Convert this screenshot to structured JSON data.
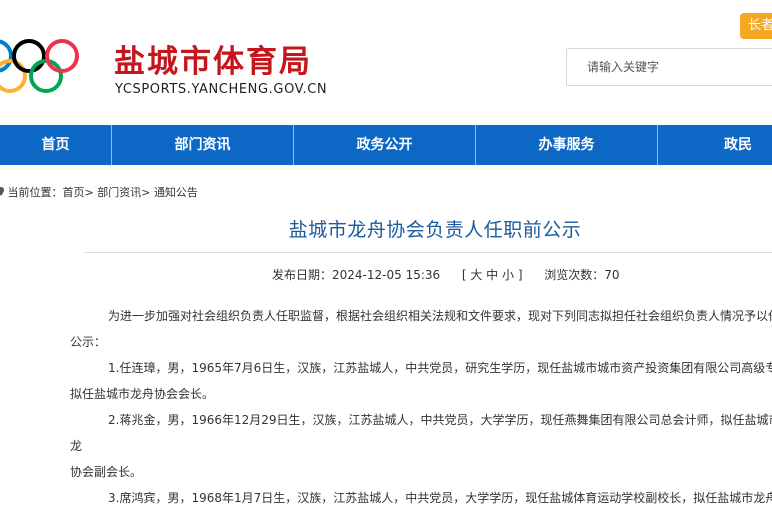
{
  "header": {
    "site_title": "盐城市体育局",
    "site_domain": "YCSPORTS.YANCHENG.GOV.CN",
    "elder_mode_label": "长者",
    "search_placeholder": "请输入关键字",
    "ring_colors": [
      "#0081c8",
      "#fcb131",
      "#000000",
      "#00a651",
      "#ee334e"
    ]
  },
  "nav": {
    "items": [
      "首页",
      "部门资讯",
      "政务公开",
      "办事服务",
      "政民"
    ]
  },
  "breadcrumb": {
    "prefix": "当前位置：",
    "items": [
      "首页",
      "部门资讯",
      "通知公告"
    ],
    "separator": ">"
  },
  "article": {
    "title": "盐城市龙舟协会负责人任职前公示",
    "meta": {
      "date_label": "发布日期：",
      "date": "2024-12-05 15:36",
      "size_open": "[",
      "size_large": "大",
      "size_medium": "中",
      "size_small": "小",
      "size_close": "]",
      "views_label": "浏览次数：",
      "views": "70"
    },
    "paragraphs": [
      {
        "first": "为进一步加强对社会组织负责人任职监督，根据社会组织相关法规和文件要求，现对下列同志拟担任社会组织负责人情况予以任",
        "rest": "公示："
      },
      {
        "first": "1.任连璋，男，1965年7月6日生，汉族，江苏盐城人，中共党员，研究生学历，现任盐城市城市资产投资集团有限公司高级专务",
        "rest": "拟任盐城市龙舟协会会长。"
      },
      {
        "first": "2.蒋兆金，男，1966年12月29日生，汉族，江苏盐城人，中共党员，大学学历，现任燕舞集团有限公司总会计师，拟任盐城市龙",
        "rest": "协会副会长。"
      },
      {
        "first": "3.席鸿宾，男，1968年1月7日生，汉族，江苏盐城人，中共党员，大学学历，现任盐城体育运动学校副校长，拟任盐城市龙舟协",
        "rest": ""
      }
    ]
  }
}
